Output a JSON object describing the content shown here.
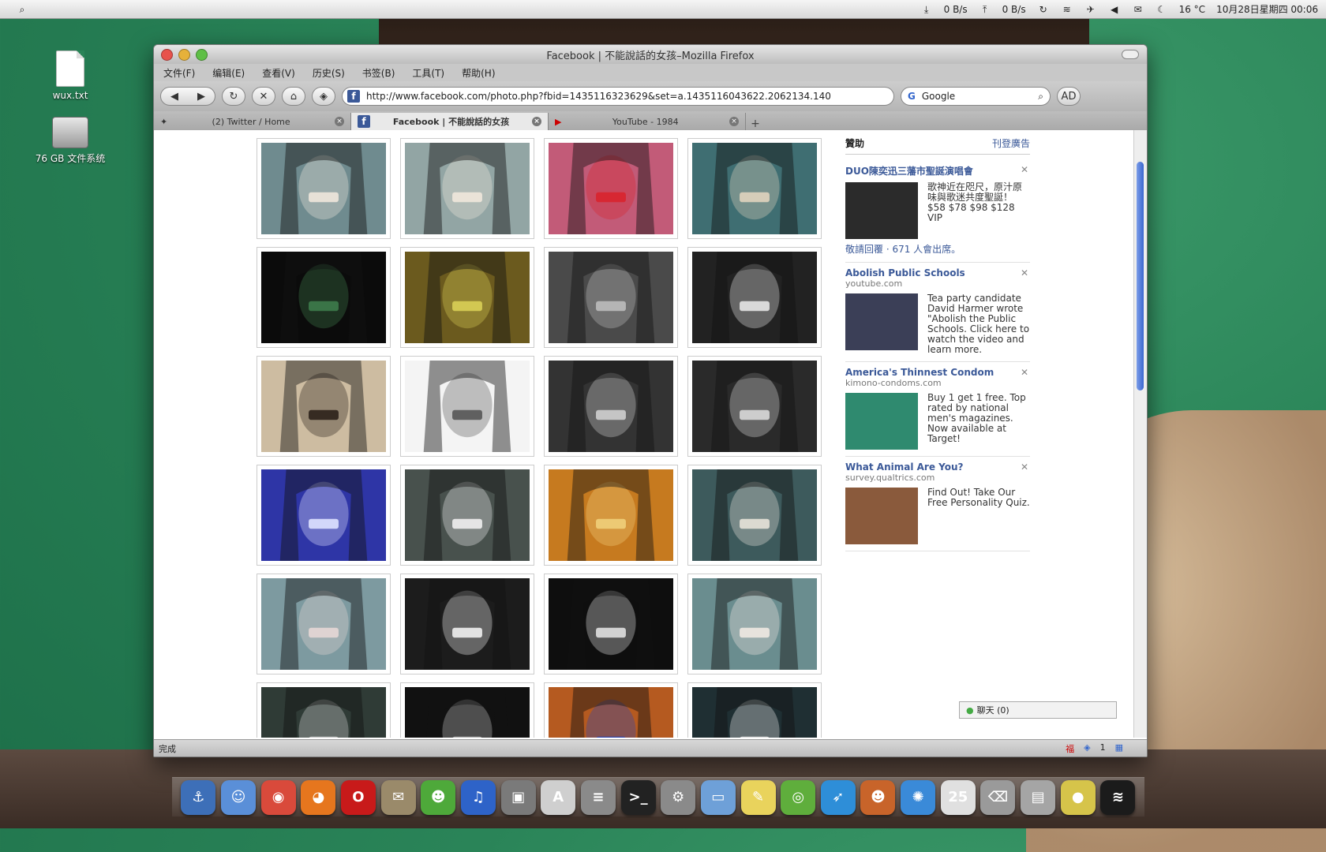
{
  "menubar": {
    "right_items": [
      "0 B/s",
      "0 B/s",
      "16 °C",
      "10月28日星期四 00:06"
    ]
  },
  "desktop": {
    "icons": [
      "wux.txt",
      "76 GB 文件系统"
    ]
  },
  "window": {
    "title": "Facebook | 不能說話的女孩–Mozilla Firefox",
    "menu": [
      "文件(F)",
      "编辑(E)",
      "查看(V)",
      "历史(S)",
      "书签(B)",
      "工具(T)",
      "帮助(H)"
    ],
    "url": "http://www.facebook.com/photo.php?fbid=1435116323629&set=a.1435116043622.2062134.140",
    "search_placeholder": "Google",
    "ad_button": "AD",
    "tabs": [
      {
        "label": "(2) Twitter / Home",
        "active": false
      },
      {
        "label": "Facebook | 不能說話的女孩",
        "active": true
      },
      {
        "label": "YouTube - 1984",
        "active": false
      }
    ],
    "status": "完成",
    "status_count": "1"
  },
  "photos": [
    {
      "bg": "#6f8b8f",
      "accent": "#efe7dc"
    },
    {
      "bg": "#92a5a4",
      "accent": "#efe7dc"
    },
    {
      "bg": "#c25b78",
      "accent": "#d8242d"
    },
    {
      "bg": "#3f6e72",
      "accent": "#e0d4be"
    },
    {
      "bg": "#0b0b0b",
      "accent": "#3e7b4b"
    },
    {
      "bg": "#6b5a1e",
      "accent": "#d9cf57"
    },
    {
      "bg": "#4a4a4a",
      "accent": "#bdbdbd"
    },
    {
      "bg": "#222222",
      "accent": "#e5e5e5"
    },
    {
      "bg": "#cdbca1",
      "accent": "#2b211a"
    },
    {
      "bg": "#f4f4f4",
      "accent": "#555555"
    },
    {
      "bg": "#333333",
      "accent": "#cfcfcf"
    },
    {
      "bg": "#2a2a2a",
      "accent": "#d8d8d8"
    },
    {
      "bg": "#2e35a6",
      "accent": "#dfe2ff"
    },
    {
      "bg": "#48514d",
      "accent": "#efefef"
    },
    {
      "bg": "#c67a1f",
      "accent": "#f0cf7a"
    },
    {
      "bg": "#3d5a5c",
      "accent": "#e7e3d9"
    },
    {
      "bg": "#7d9aa0",
      "accent": "#e6d7d5"
    },
    {
      "bg": "#1c1c1c",
      "accent": "#efefef"
    },
    {
      "bg": "#0e0e0e",
      "accent": "#e0e0e0"
    },
    {
      "bg": "#6a8d8f",
      "accent": "#f0e9e2"
    },
    {
      "bg": "#2f3b36",
      "accent": "#cfcfcf"
    },
    {
      "bg": "#111111",
      "accent": "#bfbfbf"
    },
    {
      "bg": "#b55a20",
      "accent": "#2744b5"
    },
    {
      "bg": "#1f2f33",
      "accent": "#e8e8e8"
    }
  ],
  "sidebar": {
    "header": "贊助",
    "header_link": "刊登廣告",
    "ads": [
      {
        "title": "DUO陳奕迅三藩市聖誕演唱會",
        "domain": "",
        "text": "歌神近在咫尺，原汁原味與歌迷共度聖誕！$58 $78 $98 $128 VIP",
        "img_color": "#2b2b2b",
        "event": "敬請回覆 · 671 人會出席。"
      },
      {
        "title": "Abolish Public Schools",
        "domain": "youtube.com",
        "text": "Tea party candidate David Harmer wrote \"Abolish the Public Schools. Click here to watch the video and learn more.",
        "img_color": "#3b3f57",
        "event": ""
      },
      {
        "title": "America's Thinnest Condom",
        "domain": "kimono-condoms.com",
        "text": "Buy 1 get 1 free. Top rated by national men's magazines. Now available at Target!",
        "img_color": "#2f8a6f",
        "event": ""
      },
      {
        "title": "What Animal Are You?",
        "domain": "survey.qualtrics.com",
        "text": "Find Out! Take Our Free Personality Quiz.",
        "img_color": "#8a5a3c",
        "event": ""
      }
    ],
    "chat": "聊天 (0)"
  },
  "dock": {
    "items": [
      {
        "name": "anchor-icon",
        "color": "#3d6fb8",
        "glyph": "⚓"
      },
      {
        "name": "finder-icon",
        "color": "#5a8fd8",
        "glyph": "☺"
      },
      {
        "name": "chrome-icon",
        "color": "#d94a3b",
        "glyph": "◉"
      },
      {
        "name": "firefox-icon",
        "color": "#e6761e",
        "glyph": "◕"
      },
      {
        "name": "opera-icon",
        "color": "#c81a1a",
        "glyph": "O"
      },
      {
        "name": "mail-stamp-icon",
        "color": "#9a8a6a",
        "glyph": "✉"
      },
      {
        "name": "adium-icon",
        "color": "#4ea93a",
        "glyph": "☻"
      },
      {
        "name": "itunes-icon",
        "color": "#2e63c8",
        "glyph": "♫"
      },
      {
        "name": "preview-icon",
        "color": "#7a7a7a",
        "glyph": "▣"
      },
      {
        "name": "textedit-icon",
        "color": "#cfcfcf",
        "glyph": "A"
      },
      {
        "name": "calculator-icon",
        "color": "#8a8a8a",
        "glyph": "≡"
      },
      {
        "name": "terminal-icon",
        "color": "#222222",
        "glyph": ">_"
      },
      {
        "name": "system-prefs-icon",
        "color": "#8a8a8a",
        "glyph": "⚙"
      },
      {
        "name": "folder-icon",
        "color": "#6ea0d8",
        "glyph": "▭"
      },
      {
        "name": "stickies-icon",
        "color": "#e9d35c",
        "glyph": "✎"
      },
      {
        "name": "ubuntu-icon",
        "color": "#5fae3c",
        "glyph": "◎"
      },
      {
        "name": "bird-icon",
        "color": "#2e8ed8",
        "glyph": "➶"
      },
      {
        "name": "red-panda-icon",
        "color": "#c8642a",
        "glyph": "☻"
      },
      {
        "name": "swirl-icon",
        "color": "#3a8ad8",
        "glyph": "✺"
      },
      {
        "name": "ical-icon",
        "color": "#e0e0e0",
        "glyph": "25"
      },
      {
        "name": "trash-icon",
        "color": "#9a9a9a",
        "glyph": "⌫"
      },
      {
        "name": "disk-icon",
        "color": "#a5a5a5",
        "glyph": "▤"
      },
      {
        "name": "orb-icon",
        "color": "#d6c44a",
        "glyph": "●"
      },
      {
        "name": "wifi-icon",
        "color": "#1b1b1b",
        "glyph": "≋"
      }
    ]
  }
}
